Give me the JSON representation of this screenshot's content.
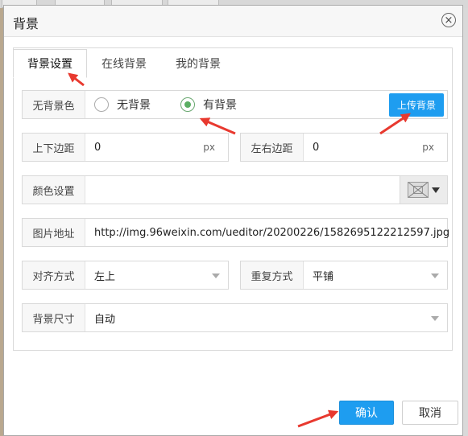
{
  "dialog": {
    "title": "背景",
    "close_glyph": "×"
  },
  "tabs": [
    {
      "label": "背景设置",
      "active": true
    },
    {
      "label": "在线背景",
      "active": false
    },
    {
      "label": "我的背景",
      "active": false
    }
  ],
  "background_toggle": {
    "label": "无背景色",
    "options": [
      {
        "label": "无背景",
        "checked": false
      },
      {
        "label": "有背景",
        "checked": true
      }
    ],
    "upload_label": "上传背景"
  },
  "margins": {
    "vertical": {
      "label": "上下边距",
      "value": "0",
      "unit": "px"
    },
    "horizontal": {
      "label": "左右边距",
      "value": "0",
      "unit": "px"
    }
  },
  "color": {
    "label": "颜色设置",
    "value": ""
  },
  "image_url": {
    "label": "图片地址",
    "value": "http://img.96weixin.com/ueditor/20200226/1582695122212597.jpg"
  },
  "alignment": {
    "label": "对齐方式",
    "value": "左上"
  },
  "repeat": {
    "label": "重复方式",
    "value": "平铺"
  },
  "size": {
    "label": "背景尺寸",
    "value": "自动"
  },
  "footer": {
    "confirm_label": "确认",
    "cancel_label": "取消"
  },
  "colors": {
    "primary": "#1e9df0",
    "radio_checked": "#5aae63",
    "annotation": "#e8392f"
  }
}
